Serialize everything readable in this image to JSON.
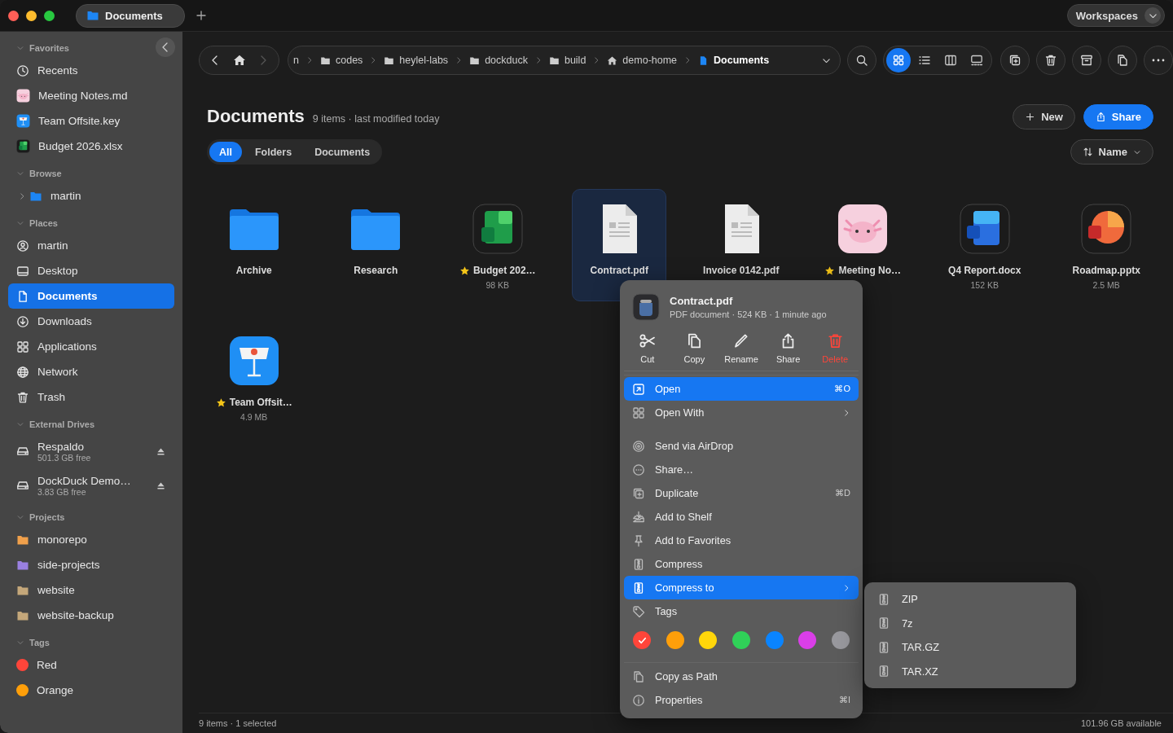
{
  "window": {
    "tab": "Documents",
    "workspaces": "Workspaces"
  },
  "sidebar": {
    "sections": [
      {
        "title": "Favorites",
        "expanded": true,
        "items": [
          {
            "label": "Recents",
            "kind": "clock",
            "selected": false
          },
          {
            "label": "Meeting Notes.md",
            "kind": "md",
            "selected": false
          },
          {
            "label": "Team Offsite.key",
            "kind": "key",
            "selected": false
          },
          {
            "label": "Budget 2026.xlsx",
            "kind": "xlsx",
            "selected": false
          }
        ]
      },
      {
        "title": "Browse",
        "expanded": true,
        "items": [
          {
            "label": "martin",
            "kind": "tree",
            "expanded": false,
            "selected": false
          }
        ]
      },
      {
        "title": "Places",
        "expanded": true,
        "items": [
          {
            "label": "martin",
            "kind": "person",
            "selected": false
          },
          {
            "label": "Desktop",
            "kind": "desktop",
            "selected": false
          },
          {
            "label": "Documents",
            "kind": "doc",
            "selected": true
          },
          {
            "label": "Downloads",
            "kind": "download",
            "selected": false
          },
          {
            "label": "Applications",
            "kind": "apps",
            "selected": false
          },
          {
            "label": "Network",
            "kind": "globe",
            "selected": false
          },
          {
            "label": "Trash",
            "kind": "trash",
            "selected": false
          }
        ]
      },
      {
        "title": "External Drives",
        "expanded": true,
        "items": [
          {
            "label": "Respaldo",
            "detail": "501.3 GB free",
            "kind": "drive",
            "selected": false
          },
          {
            "label": "DockDuck Demo…",
            "detail": "3.83 GB free",
            "kind": "drive",
            "selected": false
          }
        ]
      },
      {
        "title": "Projects",
        "expanded": true,
        "items": [
          {
            "label": "monorepo",
            "kind": "folder",
            "color": "#f0a04b",
            "selected": false
          },
          {
            "label": "side-projects",
            "kind": "folder",
            "color": "#9a80e0",
            "selected": false
          },
          {
            "label": "website",
            "kind": "folder",
            "color": "#c4a77a",
            "selected": false
          },
          {
            "label": "website-backup",
            "kind": "folder",
            "color": "#c4a77a",
            "selected": false
          }
        ]
      },
      {
        "title": "Tags",
        "expanded": true,
        "items": [
          {
            "label": "Red",
            "kind": "tag",
            "color": "#ff453a",
            "selected": false
          },
          {
            "label": "Orange",
            "kind": "tag",
            "color": "#ff9f0a",
            "selected": false
          }
        ]
      }
    ]
  },
  "toolbar": {
    "path": [
      {
        "label": "n",
        "kind": "plain",
        "selected": false
      },
      {
        "label": "codes",
        "kind": "folder",
        "selected": false
      },
      {
        "label": "heylel-labs",
        "kind": "folder",
        "selected": false
      },
      {
        "label": "dockduck",
        "kind": "folder",
        "selected": false
      },
      {
        "label": "build",
        "kind": "folder",
        "selected": false
      },
      {
        "label": "demo-home",
        "kind": "home",
        "selected": false
      },
      {
        "label": "Documents",
        "kind": "doc",
        "selected": true
      }
    ],
    "view_modes": [
      {
        "kind": "grid",
        "selected": true
      },
      {
        "kind": "list",
        "selected": false
      },
      {
        "kind": "columns",
        "selected": false
      },
      {
        "kind": "gallery",
        "selected": false
      }
    ]
  },
  "heading": {
    "title": "Documents",
    "meta": "9 items · last modified today"
  },
  "buttons": [
    {
      "label": "New",
      "kind": "new"
    },
    {
      "label": "Share",
      "kind": "share"
    }
  ],
  "filters": [
    {
      "label": "All",
      "selected": true
    },
    {
      "label": "Folders",
      "selected": false
    },
    {
      "label": "Documents",
      "selected": false
    }
  ],
  "sort": {
    "label": "Name"
  },
  "files": [
    {
      "name": "Archive",
      "kind": "folder",
      "starred": false,
      "selected": false
    },
    {
      "name": "Research",
      "kind": "folder",
      "starred": false,
      "selected": false
    },
    {
      "name": "Budget 202…",
      "size": "98 KB",
      "kind": "xlsx",
      "starred": true,
      "selected": false
    },
    {
      "name": "Contract.pdf",
      "kind": "pdf",
      "starred": false,
      "selected": true
    },
    {
      "name": "Invoice 0142.pdf",
      "kind": "pdf",
      "starred": false,
      "selected": false
    },
    {
      "name": "Meeting No…",
      "kind": "md",
      "starred": true,
      "selected": false
    },
    {
      "name": "Q4 Report.docx",
      "size": "152 KB",
      "kind": "docx",
      "starred": false,
      "selected": false
    },
    {
      "name": "Roadmap.pptx",
      "size": "2.5 MB",
      "kind": "pptx",
      "starred": false,
      "selected": false
    },
    {
      "name": "Team Offsit…",
      "size": "4.9 MB",
      "kind": "key",
      "starred": true,
      "selected": false
    }
  ],
  "status_bar": {
    "left": "9 items · 1 selected",
    "right": "101.96 GB available"
  },
  "context_menu": {
    "title": "Contract.pdf",
    "subtitle": "PDF document · 524 KB · 1 minute ago",
    "actions": [
      {
        "label": "Cut",
        "kind": "cut",
        "danger": false
      },
      {
        "label": "Copy",
        "kind": "copy",
        "danger": false
      },
      {
        "label": "Rename",
        "kind": "rename",
        "danger": false
      },
      {
        "label": "Share",
        "kind": "share",
        "danger": false
      },
      {
        "label": "Delete",
        "kind": "delete",
        "danger": true
      }
    ],
    "sections": [
      {
        "kind": "items",
        "items": [
          {
            "label": "Open",
            "shortcut": "⌘O",
            "kind": "open",
            "submenu": false,
            "selected": true
          },
          {
            "label": "Open With",
            "kind": "apps",
            "submenu": true,
            "selected": false
          }
        ]
      },
      {
        "kind": "items",
        "items": [
          {
            "label": "Send via AirDrop",
            "kind": "airdrop",
            "submenu": false,
            "selected": false
          },
          {
            "label": "Share…",
            "kind": "ellipsis",
            "submenu": false,
            "selected": false
          },
          {
            "label": "Duplicate",
            "shortcut": "⌘D",
            "kind": "duplicate",
            "submenu": false,
            "selected": false
          },
          {
            "label": "Add to Shelf",
            "kind": "tray",
            "submenu": false,
            "selected": false
          },
          {
            "label": "Add to Favorites",
            "kind": "pin",
            "submenu": false,
            "selected": false
          },
          {
            "label": "Compress",
            "kind": "zip",
            "submenu": false,
            "selected": false
          },
          {
            "label": "Compress to",
            "kind": "zip",
            "submenu": true,
            "selected": true
          },
          {
            "label": "Tags",
            "kind": "tag",
            "submenu": false,
            "selected": false
          }
        ]
      },
      {
        "kind": "colors",
        "colors": [
          {
            "color": "#ff453a",
            "checked": true
          },
          {
            "color": "#ff9f0a",
            "checked": false
          },
          {
            "color": "#ffd60a",
            "checked": false
          },
          {
            "color": "#30d158",
            "checked": false
          },
          {
            "color": "#0a84ff",
            "checked": false
          },
          {
            "color": "#da3ee8",
            "checked": false
          },
          {
            "color": "#98989d",
            "checked": false
          }
        ]
      },
      {
        "kind": "items",
        "items": [
          {
            "label": "Copy as Path",
            "kind": "copydoc",
            "submenu": false,
            "selected": false
          },
          {
            "label": "Properties",
            "shortcut": "⌘I",
            "kind": "info",
            "submenu": false,
            "selected": false
          }
        ]
      }
    ]
  },
  "submenu": {
    "items": [
      {
        "label": "ZIP"
      },
      {
        "label": "7z"
      },
      {
        "label": "TAR.GZ"
      },
      {
        "label": "TAR.XZ"
      }
    ]
  }
}
